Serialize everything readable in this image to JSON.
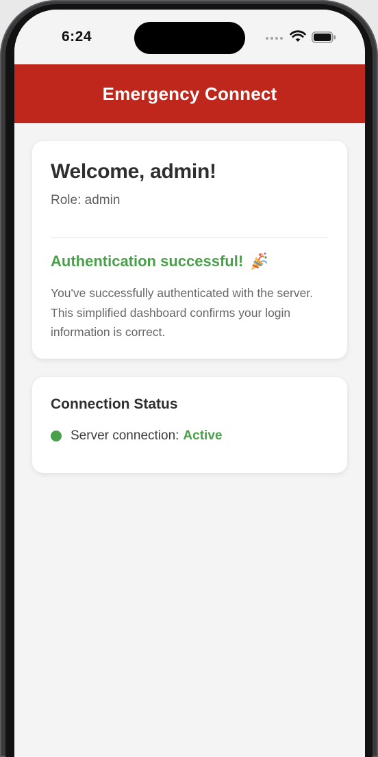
{
  "status_bar": {
    "time": "6:24",
    "icons": [
      "signal-dots-icon",
      "wifi-icon",
      "battery-icon"
    ]
  },
  "header": {
    "title": "Emergency Connect"
  },
  "welcome_card": {
    "heading": "Welcome, admin!",
    "role": "Role: admin",
    "auth_title": "Authentication successful!",
    "auth_icon": "party-popper-icon",
    "auth_description": "You've successfully authenticated with the server. This simplified dashboard confirms your login information is correct."
  },
  "status_card": {
    "heading": "Connection Status",
    "label": "Server connection:",
    "value": "Active"
  },
  "colors": {
    "header_red": "#bf271d",
    "success_green": "#4aa04a",
    "background": "#f4f4f4"
  }
}
